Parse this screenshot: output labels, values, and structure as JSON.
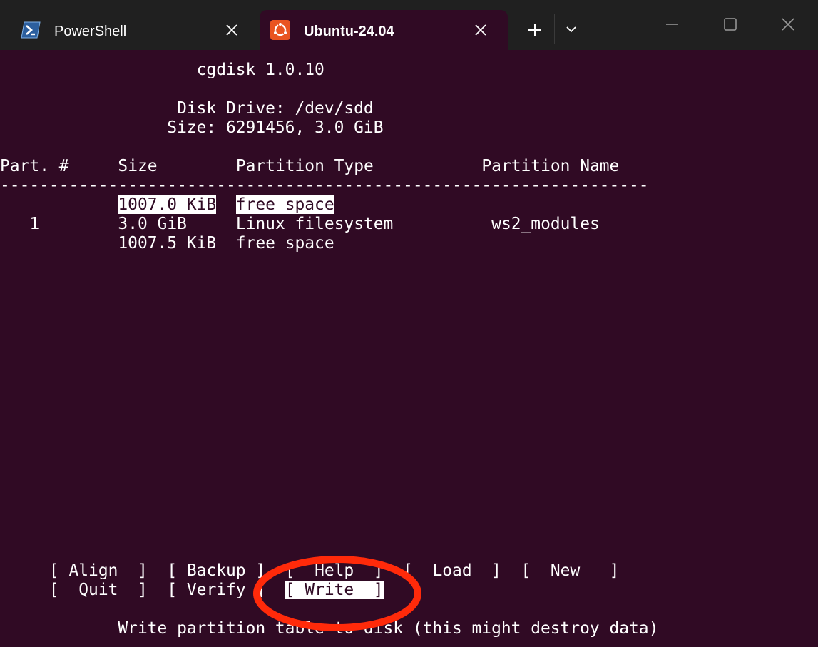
{
  "tabs": [
    {
      "label": "PowerShell",
      "icon": "powershell-icon"
    },
    {
      "label": "Ubuntu-24.04",
      "icon": "ubuntu-icon"
    }
  ],
  "colors": {
    "terminal_bg": "#300a24",
    "titlebar_bg": "#202020",
    "ubuntu_orange": "#e95420",
    "annotation_red": "#ff2a0a"
  },
  "app": {
    "title": "cgdisk 1.0.10",
    "disk_drive": "Disk Drive: /dev/sdd",
    "size_info": "Size: 6291456, 3.0 GiB"
  },
  "table": {
    "headers": {
      "part": "Part. #",
      "size": "Size",
      "type": "Partition Type",
      "name": "Partition Name"
    },
    "separator": "------------------------------------------------------------------",
    "rows": [
      {
        "part": "",
        "size": "1007.0 KiB",
        "type": "free space",
        "name": "",
        "selected": true
      },
      {
        "part": "1",
        "size": "3.0 GiB",
        "type": "Linux filesystem",
        "name": "ws2_modules",
        "selected": false
      },
      {
        "part": "",
        "size": "1007.5 KiB",
        "type": "free space",
        "name": "",
        "selected": false
      }
    ]
  },
  "menu": {
    "align": "[ Align  ]",
    "backup": "[ Backup ]",
    "help": "[  Help  ]",
    "load": "[  Load  ]",
    "new": "[  New   ]",
    "quit": "[  Quit  ]",
    "verify": "[ Verify ]",
    "write": "[ Write  ]"
  },
  "status": "Write partition table to disk (this might destroy data)"
}
